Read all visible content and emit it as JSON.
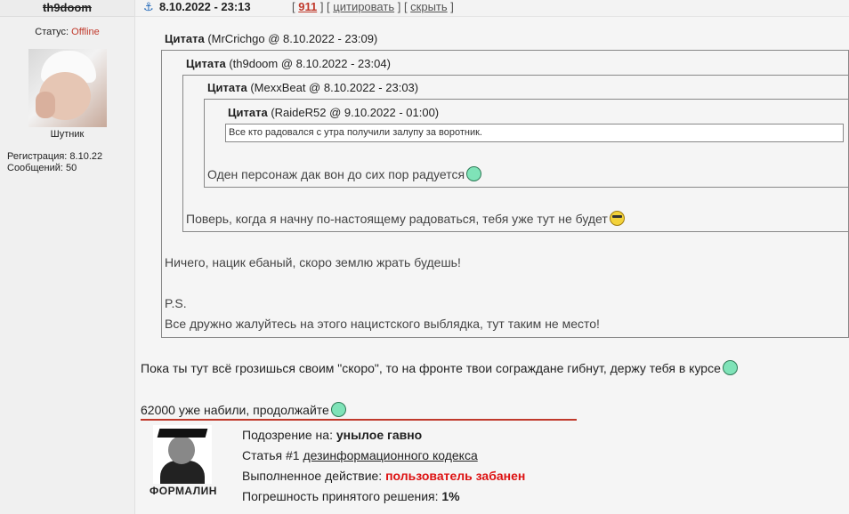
{
  "user": {
    "name": "th9doom",
    "status_label": "Статус:",
    "status_value": "Offline",
    "rank": "Шутник",
    "registration": "Регистрация: 8.10.22",
    "messages": "Сообщений: 50"
  },
  "header": {
    "date": "8.10.2022 - 23:13",
    "post_number": "911",
    "quote_label": "цитировать",
    "hide_label": "скрыть"
  },
  "quotes": [
    {
      "label": "Цитата",
      "meta": "(MrCrichgo @ 8.10.2022 - 23:09)"
    },
    {
      "label": "Цитата",
      "meta": "(th9doom @ 8.10.2022 - 23:04)"
    },
    {
      "label": "Цитата",
      "meta": "(MexxBeat @ 8.10.2022 - 23:03)"
    },
    {
      "label": "Цитата",
      "meta": "(RaideR52 @ 9.10.2022 - 01:00)"
    }
  ],
  "texts": {
    "q4": "Все кто радовался с утра получили залупу за воротник.",
    "q3": "Оден персонаж дак вон до сих пор радуется",
    "q2": "Поверь, когда я начну по-настоящему радоваться, тебя уже тут не будет",
    "q1_line1": "Ничего, нацик ебаный, скоро землю жрать будешь!",
    "q1_ps": "P.S.",
    "q1_line2": "Все дружно жалуйтесь на этого нацистского выблядка, тут таким не место!",
    "main1": "Пока ты тут всё грозишься своим \"скоро\", то на фронте твои сограждане гибнут, держу тебя в курсе",
    "main2": "62000 уже набили, продолжайте"
  },
  "moderation": {
    "name": "ФОРМАЛИН",
    "l1_label": "Подозрение на:",
    "l1_value": "унылое гавно",
    "l2_label": "Статья #1",
    "l2_link": "дезинформационного кодекса",
    "l3_label": "Выполненное действие:",
    "l3_value": "пользователь забанен",
    "l4_label": "Погрешность принятого решения:",
    "l4_value": "1%"
  }
}
